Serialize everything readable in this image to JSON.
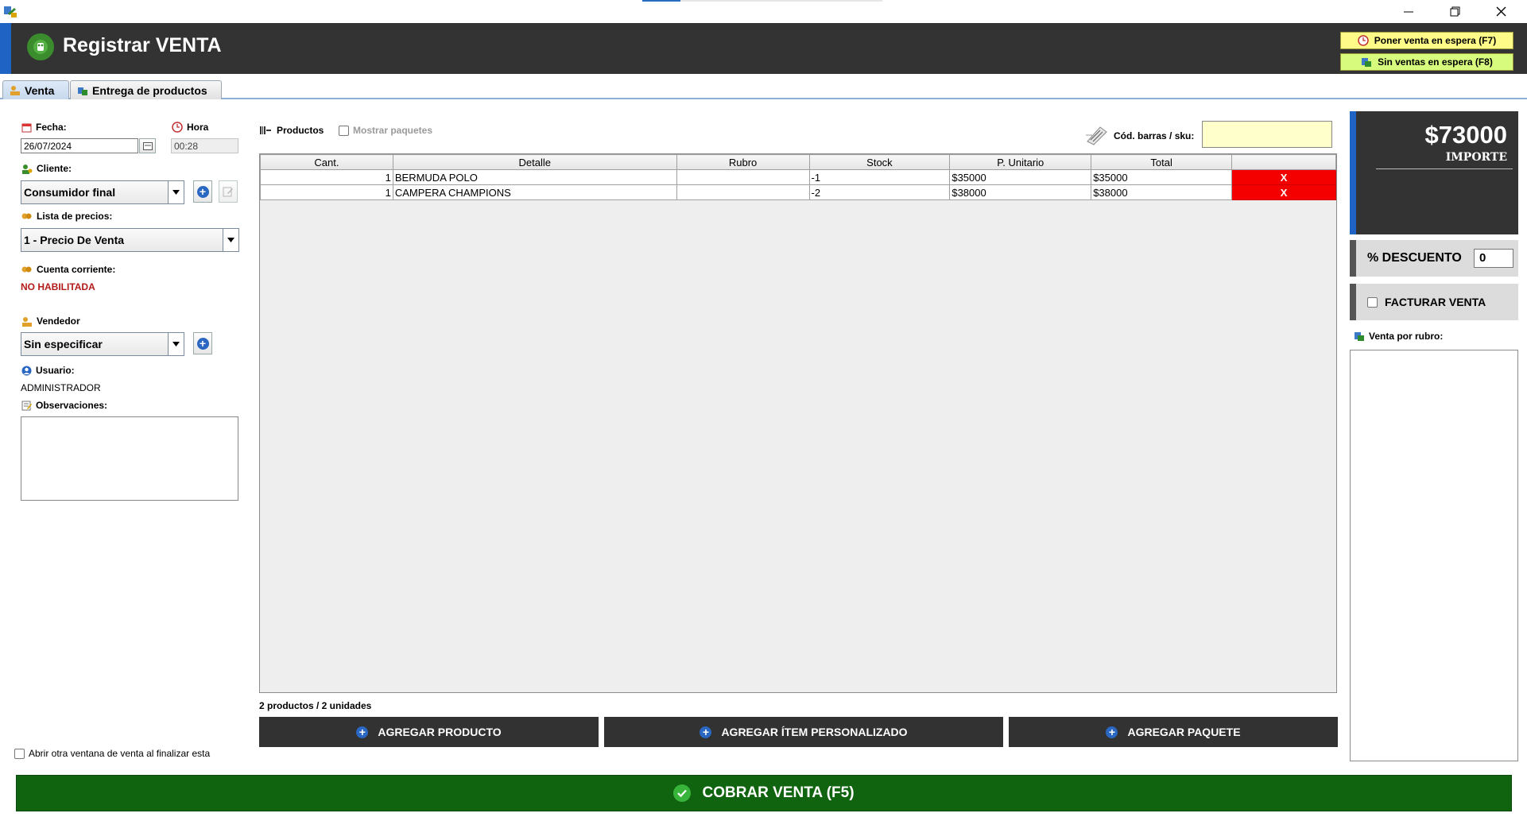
{
  "window": {
    "minimize": "—",
    "restore": "❐",
    "close": "✕",
    "progress_fraction": 0.16
  },
  "header": {
    "title": "Registrar VENTA",
    "hold_button": "Poner venta en espera (F7)",
    "no_hold_button": "Sin ventas en espera (F8)"
  },
  "tabs": [
    {
      "label": "Venta",
      "active": true
    },
    {
      "label": "Entrega de productos",
      "active": false
    }
  ],
  "left": {
    "fecha_label": "Fecha:",
    "fecha_value": "26/07/2024",
    "hora_label": "Hora",
    "hora_value": "00:28",
    "cliente_label": "Cliente:",
    "cliente_value": "Consumidor final",
    "lista_label": "Lista de precios:",
    "lista_value": "1 - Precio De Venta",
    "cuenta_label": "Cuenta corriente:",
    "cuenta_value": "NO HABILITADA",
    "vendedor_label": "Vendedor",
    "vendedor_value": "Sin especificar",
    "usuario_label": "Usuario:",
    "usuario_value": "ADMINISTRADOR",
    "obs_label": "Observaciones:",
    "obs_value": "",
    "abrir_otra": "Abrir otra ventana de venta al finalizar esta"
  },
  "products": {
    "section_label": "Productos",
    "mostrar_paquetes": "Mostrar paquetes",
    "barcode_label": "Cód. barras / sku:",
    "barcode_value": "",
    "columns": [
      "Cant.",
      "Detalle",
      "Rubro",
      "Stock",
      "P. Unitario",
      "Total",
      ""
    ],
    "rows": [
      {
        "cant": "1",
        "detalle": "BERMUDA POLO",
        "rubro": "",
        "stock": "-1",
        "unitario": "$35000",
        "total": "$35000",
        "delete": "X"
      },
      {
        "cant": "1",
        "detalle": "CAMPERA CHAMPIONS",
        "rubro": "",
        "stock": "-2",
        "unitario": "$38000",
        "total": "$38000",
        "delete": "X"
      }
    ],
    "summary": "2 productos / 2 unidades"
  },
  "buttons": {
    "agregar_producto": "AGREGAR PRODUCTO",
    "agregar_item": "AGREGAR ÍTEM PERSONALIZADO",
    "agregar_paquete": "AGREGAR PAQUETE",
    "cobrar": "COBRAR VENTA (F5)"
  },
  "right": {
    "importe_value": "$73000",
    "importe_label": "IMPORTE",
    "descuento_label": "% DESCUENTO",
    "descuento_value": "0",
    "facturar_label": "FACTURAR VENTA",
    "venta_rubro_label": "Venta por rubro:"
  },
  "colors": {
    "header_bg": "#333333",
    "accent_blue": "#1f63c4",
    "delete_red": "#f40000",
    "cobrar_green": "#106410",
    "cuenta_red": "#b21a1a",
    "barcode_bg": "#ffffcc"
  },
  "icons": [
    "app-icon",
    "sale-logo-icon",
    "clock-icon",
    "money-icon",
    "calendar-icon",
    "user-icon",
    "barcode-scanner-icon",
    "plus-circle-icon",
    "check-circle-icon"
  ]
}
